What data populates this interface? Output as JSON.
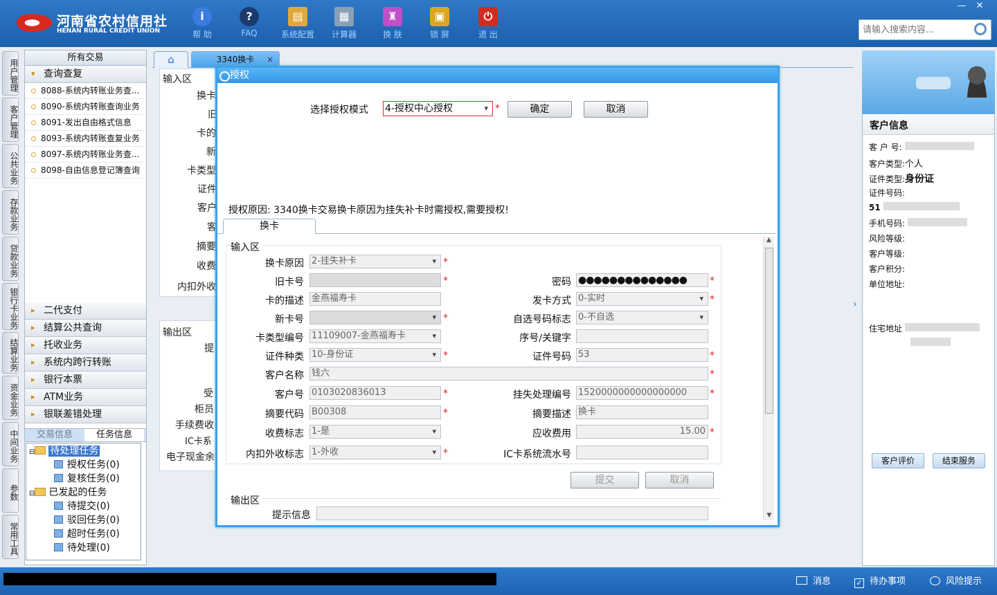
{
  "header": {
    "logo_cn": "河南省农村信用社",
    "logo_en": "HENAN RURAL CREDIT UNION",
    "tools": [
      {
        "label": "帮 助",
        "icon": "help-icon"
      },
      {
        "label": "FAQ",
        "icon": "faq-icon"
      },
      {
        "label": "系统配置",
        "icon": "toolbox-icon"
      },
      {
        "label": "计算器",
        "icon": "calculator-icon"
      },
      {
        "label": "换 肤",
        "icon": "skin-icon"
      },
      {
        "label": "锁 屏",
        "icon": "lock-icon"
      },
      {
        "label": "退 出",
        "icon": "power-icon"
      }
    ],
    "search_placeholder": "请输入搜索内容...",
    "win_min": "—",
    "win_close": "✕"
  },
  "vtabs": [
    "用户管理",
    "客户管理",
    "公共业务",
    "存款业务",
    "贷款业务",
    "银行卡业务",
    "结算业务",
    "资金业务",
    "中间业务",
    "参数",
    "常用工具"
  ],
  "sidemenu": {
    "header": "所有交易",
    "open_group": "查询查复",
    "items": [
      "8088-系统内转账业务查...",
      "8090-系统内转账查询业务",
      "8091-发出自由格式信息",
      "8093-系统内转账查复业务",
      "8097-系统内转账业务查...",
      "8098-自由信息登记簿查询"
    ],
    "groups": [
      "二代支付",
      "结算公共查询",
      "托收业务",
      "系统内跨行转账",
      "银行本票",
      "ATM业务",
      "银联差错处理"
    ]
  },
  "task_tabs": [
    "交易信息",
    "任务信息"
  ],
  "tree": {
    "pending": "待处理任务",
    "pending_children": [
      "授权任务(0)",
      "复核任务(0)"
    ],
    "initiated": "已发起的任务",
    "initiated_children": [
      "待提交(0)",
      "驳回任务(0)",
      "超时任务(0)",
      "待处理(0)"
    ]
  },
  "tabs": {
    "tab_label": "3340换卡",
    "close": "×"
  },
  "background_form": {
    "input_area": "输入区",
    "labels": [
      "换卡",
      "旧",
      "卡的",
      "新",
      "卡类型",
      "证件",
      "客户",
      "客",
      "摘要",
      "收费",
      "内扣外收"
    ],
    "output_area": "输出区",
    "out_labels": [
      "提",
      "受",
      "柜员",
      "手续费收",
      "IC卡系",
      "电子现金余"
    ]
  },
  "dialog": {
    "title": "授权",
    "mode_label": "选择授权模式",
    "mode_value": "4-授权中心授权",
    "confirm": "确定",
    "cancel": "取消",
    "reason": "授权原因: 3340换卡交易换卡原因为挂失补卡时需授权,需要授权!",
    "tab": "换卡",
    "input_area": "输入区",
    "output_area": "输出区",
    "submit": "提交",
    "cancel2": "取消",
    "hint_label": "提示信息",
    "fields": {
      "reason_label": "换卡原因",
      "reason_value": "2-挂失补卡",
      "oldcard_label": "旧卡号",
      "password_label": "密码",
      "password_value": "●●●●●●●●●●●●●●",
      "carddesc_label": "卡的描述",
      "carddesc_value": "金燕福寿卡",
      "issue_label": "发卡方式",
      "issue_value": "0-实时",
      "newcard_label": "新卡号",
      "selfnum_label": "自选号码标志",
      "selfnum_value": "0-不自选",
      "cardtype_label": "卡类型编号",
      "cardtype_value": "11109007-金燕福寿卡",
      "seq_label": "序号/关键字",
      "idtype_label": "证件种类",
      "idtype_value": "10-身份证",
      "idno_label": "证件号码",
      "idno_value": "53",
      "custname_label": "客户名称",
      "custname_value": "钱六",
      "custno_label": "客户号",
      "custno_value": "0103020836013",
      "lossno_label": "挂失处理编号",
      "lossno_value": "1520000000000000000",
      "sumcode_label": "摘要代码",
      "sumcode_value": "B00308",
      "sumdesc_label": "摘要描述",
      "sumdesc_value": "换卡",
      "fee_label": "收费标志",
      "fee_value": "1-是",
      "due_label": "应收费用",
      "due_value": "15.00",
      "inout_label": "内扣外收标志",
      "inout_value": "1-外收",
      "icseq_label": "IC卡系统流水号"
    }
  },
  "right_panel": {
    "title": "客户信息",
    "rows": [
      {
        "label": "客 户 号:",
        "value": ""
      },
      {
        "label": "客户类型:",
        "value": "个人"
      },
      {
        "label": "证件类型:",
        "value": "身份证"
      },
      {
        "label": "证件号码:",
        "value": ""
      },
      {
        "label": "51",
        "value": ""
      },
      {
        "label": "手机号码:",
        "value": ""
      },
      {
        "label": "风险等级:",
        "value": ""
      },
      {
        "label": "客户等级:",
        "value": ""
      },
      {
        "label": "客户积分:",
        "value": ""
      },
      {
        "label": "单位地址:",
        "value": ""
      }
    ],
    "home_addr": "住宅地址",
    "btn_eval": "客户评价",
    "btn_end": "结束服务"
  },
  "statusbar": {
    "msg": "消息",
    "todo": "待办事项",
    "risk": "风险提示"
  }
}
